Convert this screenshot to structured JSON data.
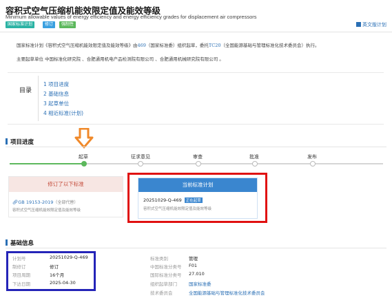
{
  "header": {
    "title": "容积式空气压缩机能效限定值及能效等级",
    "subtitle": "Minimum allowable values of energy efficiency and energy efficiency grades for displacement air compressors",
    "badges": [
      {
        "label": "国家标准计划",
        "color": "#2bb3a4"
      },
      {
        "label": "修订",
        "color": "#3aa0e0"
      },
      {
        "label": "强制性",
        "color": "#5cb85c"
      }
    ],
    "english_link": "英文版计划"
  },
  "intro": {
    "p1_a": "国家标准计划《容积式空气压缩机能效限定值及能效等级》由",
    "p1_tc": "469",
    "p1_b": "（国家标准委）组织起草，委托",
    "p1_tc2": "TC20",
    "p1_c": "（全国能源基础与管理标准化技术委员会）执行。",
    "p2": "主要起草单位 中国标准化研究院 、合肥通用机电产品检测院有限公司 、合肥通用机械研究院有限公司 。"
  },
  "toc": {
    "label": "目录",
    "items": [
      "1  项目进度",
      "2  基础信息",
      "3  起草单位",
      "4  相近标准(计划)"
    ]
  },
  "progress": {
    "heading": "项目进度",
    "steps": [
      "起草",
      "征求意见",
      "审查",
      "批准",
      "发布"
    ],
    "accent": "#5cb85c"
  },
  "cards": {
    "left": {
      "header": "修订了以下标准",
      "code": "GB 19153-2019",
      "status": "（全部代替）",
      "desc": "容积式空气压缩机能效限定值及能效等级"
    },
    "right": {
      "header": "当前标准计划",
      "code": "20251029-Q-469",
      "status": "正在起草",
      "desc": "容积式空气压缩机能效限定值及能效等级"
    }
  },
  "basic": {
    "heading": "基础信息",
    "left": [
      {
        "k": "计划号",
        "v": "20251029-Q-469"
      },
      {
        "k": "制修订",
        "v": "修订"
      },
      {
        "k": "项目周期",
        "v": "16个月"
      },
      {
        "k": "下达日期",
        "v": "2025-04-30"
      }
    ],
    "right": [
      {
        "k": "标准类别",
        "v": "管理",
        "link": false
      },
      {
        "k": "中国标准分类号",
        "v": "F01",
        "link": false
      },
      {
        "k": "国际标准分类号",
        "v": "27.010",
        "link": false
      },
      {
        "k": "组织起草部门",
        "v": "国家标准委",
        "link": true
      },
      {
        "k": "技术委员会",
        "v": "全国能源基础与管理标准化技术委员会",
        "link": true
      }
    ]
  },
  "colors": {
    "accent": "#2a6fb5",
    "highlight_red": "#e01010",
    "highlight_blue": "#2424b8",
    "arrow": "#f0892a"
  }
}
